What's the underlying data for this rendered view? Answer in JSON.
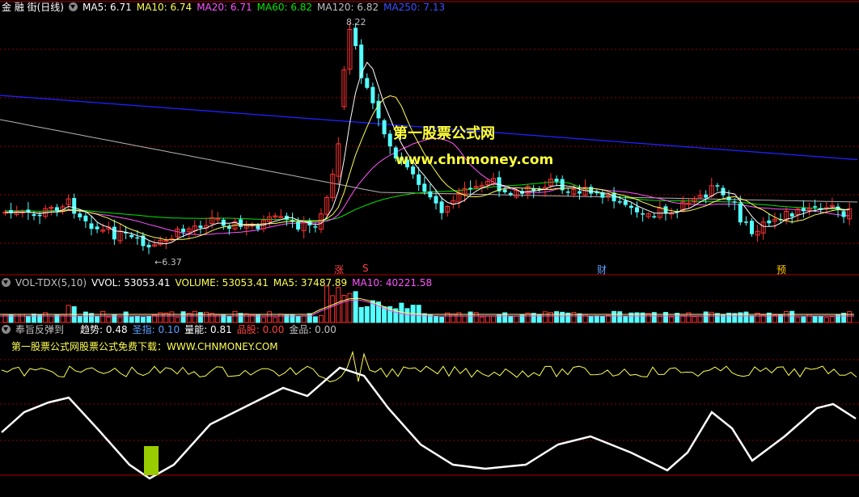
{
  "main_panel": {
    "stock_name": "金 融 街(日线)",
    "indicators": [
      {
        "label": "MA5: 6.71",
        "color": "#ffffff"
      },
      {
        "label": "MA10: 6.74",
        "color": "#ffff54"
      },
      {
        "label": "MA20: 6.71",
        "color": "#ff54ff"
      },
      {
        "label": "MA60: 6.82",
        "color": "#00e800"
      },
      {
        "label": "MA120: 6.82",
        "color": "#c0c0c0"
      },
      {
        "label": "MA250: 7.13",
        "color": "#2020ff"
      }
    ],
    "high_label": "8.22",
    "low_label": "6.37",
    "event_marks": [
      {
        "text": "涨",
        "color": "#ff4040"
      },
      {
        "text": "S",
        "color": "#ff4040"
      },
      {
        "text": "财",
        "color": "#5aa0ff"
      },
      {
        "text": "预",
        "color": "#ffcc00"
      }
    ],
    "watermark_title": "第一股票公式网",
    "watermark_url": "www.chnmoney.com"
  },
  "volume_panel": {
    "name": "VOL-TDX(5,10)",
    "indicators": [
      {
        "label": "VVOL: 53053.41",
        "color": "#ffffff"
      },
      {
        "label": "VOLUME: 53053.41",
        "color": "#ffff54"
      },
      {
        "label": "MA5: 37487.89",
        "color": "#ffff54"
      },
      {
        "label": "MA10: 40221.58",
        "color": "#ff54ff"
      }
    ]
  },
  "indicator_panel": {
    "name": "奉旨反弹到",
    "indicators": [
      {
        "label": "趋势: 0.48",
        "color": "#ffffff"
      },
      {
        "label": "圣指: 0.10",
        "color": "#5aa0ff"
      },
      {
        "label": "量能: 0.81",
        "color": "#ffffff"
      },
      {
        "label": "品股: 0.00",
        "color": "#ff4040"
      },
      {
        "label": "金品: 0.00",
        "color": "#c0c0c0"
      }
    ],
    "subtitle": "第一股票公式网股票公式免费下载：WWW.CHNMONEY.COM"
  },
  "colors": {
    "up": "#ff3232",
    "down": "#54ffff",
    "grid": "#900000"
  }
}
